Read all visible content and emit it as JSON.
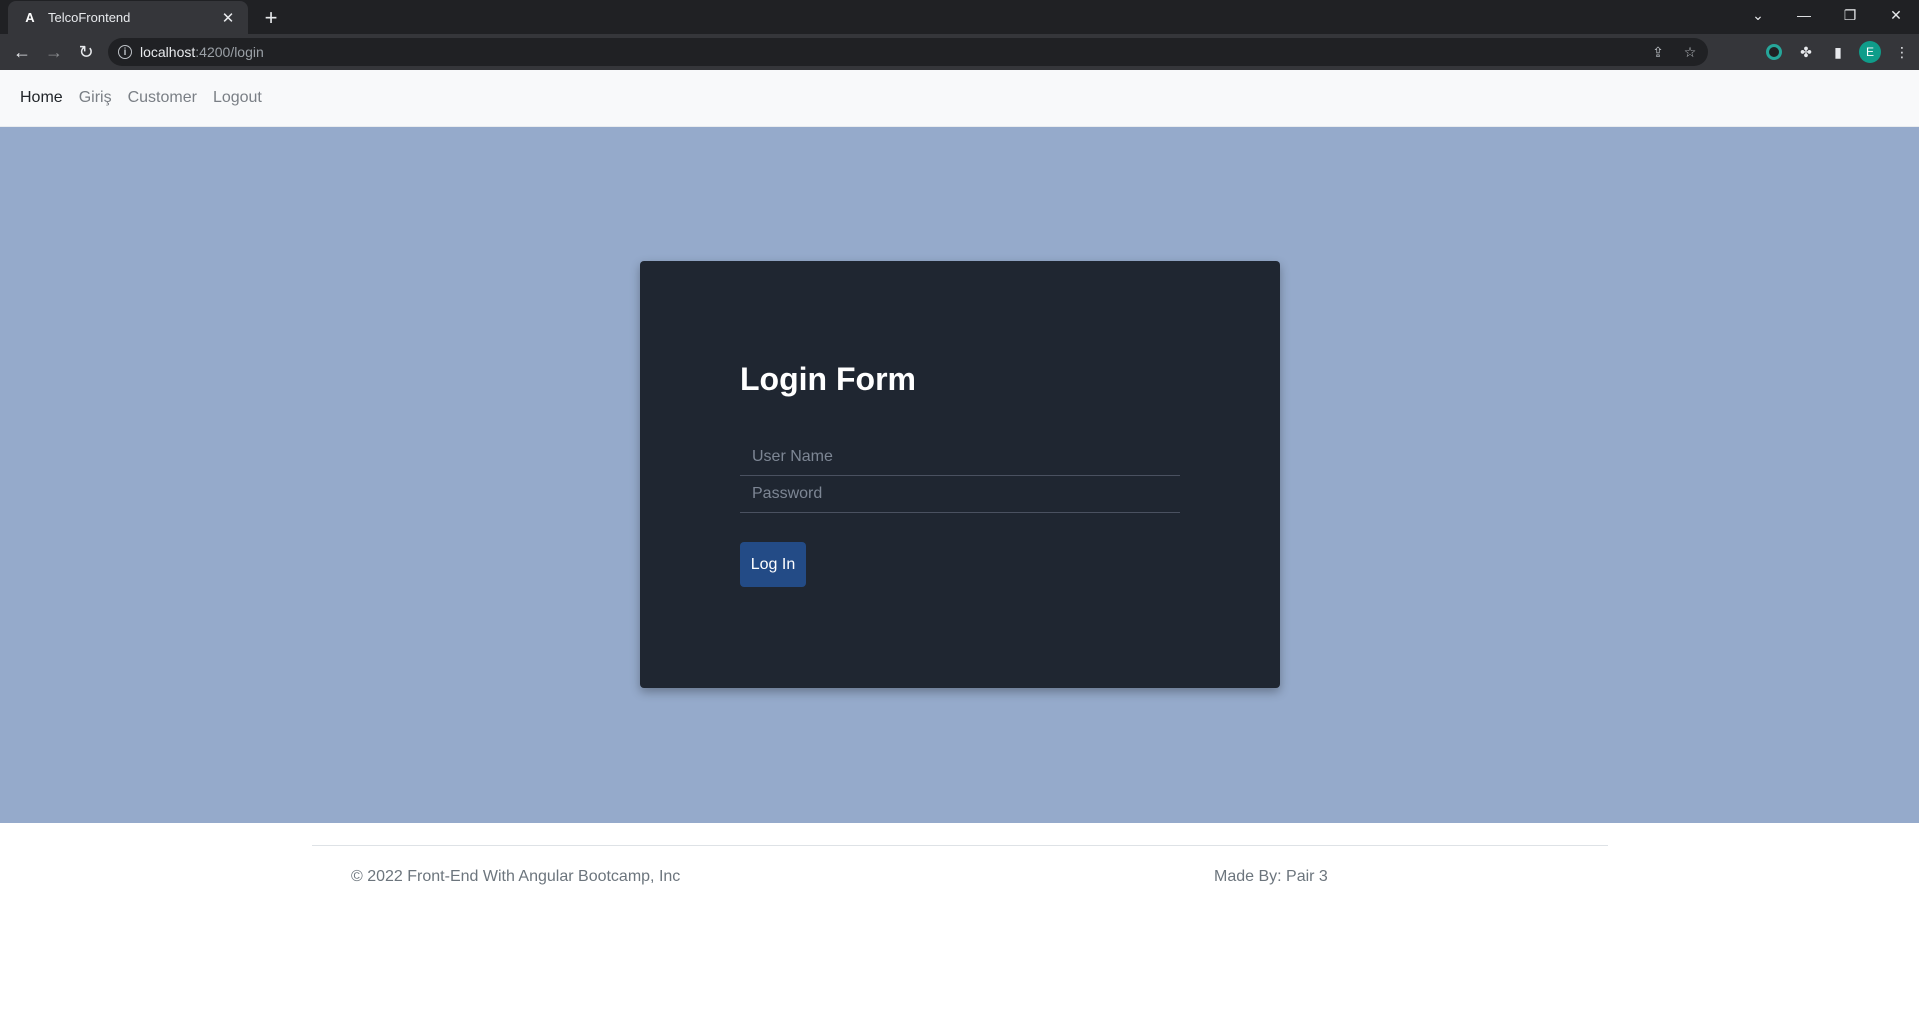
{
  "browser": {
    "tab_title": "TelcoFrontend",
    "tab_favicon": "A",
    "url_host": "localhost",
    "url_path": ":4200/login",
    "profile_initial": "E",
    "icons": {
      "back": "arrow-left-icon",
      "forward": "arrow-right-icon",
      "reload": "reload-icon",
      "info": "info-icon",
      "share": "share-icon",
      "bookmark": "star-icon",
      "extension": "extension-ring-icon",
      "puzzle": "puzzle-icon",
      "sidepanel": "side-panel-icon",
      "menu": "kebab-menu-icon"
    }
  },
  "navbar": {
    "links": [
      {
        "label": "Home",
        "active": true
      },
      {
        "label": "Giriş",
        "active": false
      },
      {
        "label": "Customer",
        "active": false
      },
      {
        "label": "Logout",
        "active": false
      }
    ]
  },
  "login_form": {
    "title": "Login Form",
    "username_placeholder": "User Name",
    "username_value": "",
    "password_placeholder": "Password",
    "password_value": "",
    "submit_label": "Log In"
  },
  "footer": {
    "copyright": "© 2022 Front-End With Angular Bootcamp, Inc",
    "credit": "Made By: Pair 3"
  },
  "colors": {
    "hero_background": "#95aacb",
    "card_background": "#1f2631",
    "button_primary": "#234b86"
  }
}
